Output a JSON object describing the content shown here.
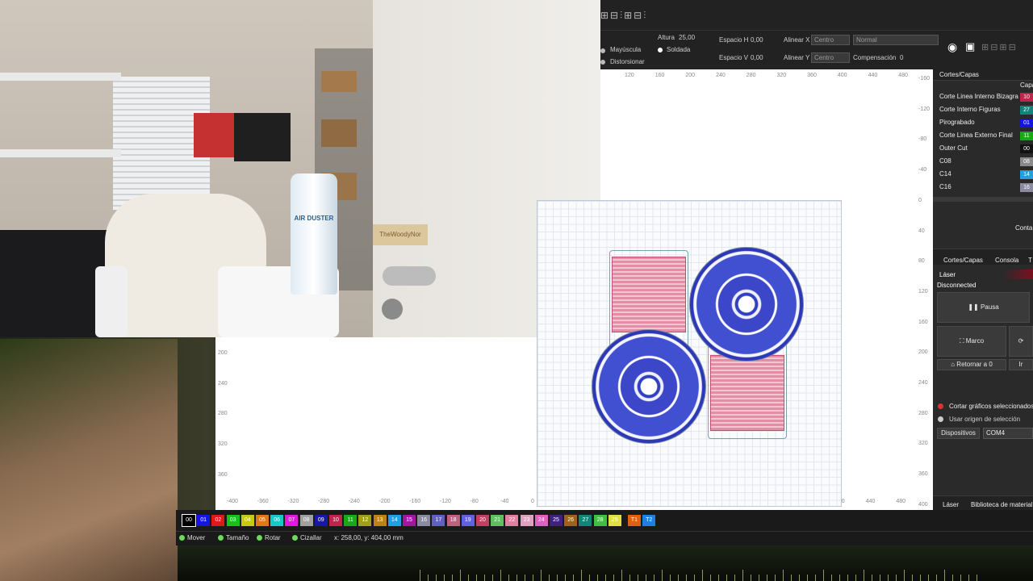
{
  "webcam": {
    "bottle_label": "AIR DUSTER",
    "nameplate": "TheWoodyNor"
  },
  "toolbar": {
    "altura_label": "Altura",
    "altura_value": "25,00",
    "mayuscula_label": "Mayúscula",
    "soldada_label": "Soldada",
    "distorsionar_label": "Distorsionar",
    "espacio_h_label": "Espacio H",
    "espacio_h_value": "0,00",
    "espacio_v_label": "Espacio V",
    "espacio_v_value": "0,00",
    "alinear_x_label": "Alinear X",
    "alinear_x_value": "Centro",
    "alinear_y_label": "Alinear Y",
    "alinear_y_value": "Centro",
    "normal_value": "Normal",
    "compensacion_label": "Compensación",
    "compensacion_value": "0"
  },
  "canvas": {
    "top_ticks": [
      "120",
      "160",
      "200",
      "240",
      "280",
      "320",
      "360",
      "400",
      "440",
      "480"
    ],
    "right_ticks": [
      "-160",
      "-120",
      "-80",
      "-40",
      "0",
      "40",
      "80",
      "120",
      "160",
      "200",
      "240",
      "280",
      "320",
      "360",
      "400"
    ],
    "bottom_ticks": [
      "-400",
      "-360",
      "-320",
      "-280",
      "-240",
      "-200",
      "-160",
      "-120",
      "-80",
      "-40",
      "0",
      "40",
      "80",
      "120",
      "160",
      "200",
      "240",
      "280",
      "320",
      "360",
      "400",
      "440",
      "480"
    ],
    "left_ticks": [
      "200",
      "240",
      "280",
      "320",
      "360"
    ]
  },
  "layers_panel": {
    "title": "Cortes/Capas",
    "col_header": "Capa",
    "layers": [
      {
        "name": "Corte Linea Interno Bizagra",
        "code": "10",
        "color": "#c0244a"
      },
      {
        "name": "Corte Interno Figuras",
        "code": "27",
        "color": "#13847a"
      },
      {
        "name": "Pirograbado",
        "code": "01",
        "color": "#1515e0"
      },
      {
        "name": "Corte Linea Externo Final",
        "code": "11",
        "color": "#18a818"
      },
      {
        "name": "Outer Cut",
        "code": "00",
        "color": "#111111"
      },
      {
        "name": "C08",
        "code": "08",
        "color": "#8a8a8a"
      },
      {
        "name": "C14",
        "code": "14",
        "color": "#20a0e0"
      },
      {
        "name": "C16",
        "code": "16",
        "color": "#8a8aa0"
      }
    ],
    "conta_text": "Conta"
  },
  "laser_panel": {
    "tab_layers": "Cortes/Capas",
    "tab_console": "Consola",
    "tab_more": "T",
    "section_title": "Láser",
    "status": "Disconnected",
    "pause_label": "Pausa",
    "frame_label": "Marco",
    "home_label": "Retornar a 0",
    "ir_label": "Ir",
    "cut_selected_label": "Cortar gráficos seleccionados",
    "use_origin_label": "Usar origen de selección",
    "devices_label": "Dispositivos",
    "port_value": "COM4",
    "bottom_tab_laser": "Láser",
    "bottom_tab_library": "Biblioteca de material"
  },
  "palette": [
    {
      "code": "00",
      "color": "#000000"
    },
    {
      "code": "01",
      "color": "#1515e0"
    },
    {
      "code": "02",
      "color": "#e01818"
    },
    {
      "code": "03",
      "color": "#18c018"
    },
    {
      "code": "04",
      "color": "#c8c818"
    },
    {
      "code": "05",
      "color": "#e07818"
    },
    {
      "code": "06",
      "color": "#18c8c8"
    },
    {
      "code": "07",
      "color": "#e018e0"
    },
    {
      "code": "08",
      "color": "#a0a0a0"
    },
    {
      "code": "09",
      "color": "#1818a0"
    },
    {
      "code": "10",
      "color": "#c0244a"
    },
    {
      "code": "11",
      "color": "#18a818"
    },
    {
      "code": "12",
      "color": "#a0a018"
    },
    {
      "code": "13",
      "color": "#c08018"
    },
    {
      "code": "14",
      "color": "#20a0e0"
    },
    {
      "code": "15",
      "color": "#a018a0"
    },
    {
      "code": "16",
      "color": "#8a8aa0"
    },
    {
      "code": "17",
      "color": "#6060c0"
    },
    {
      "code": "18",
      "color": "#c06080"
    },
    {
      "code": "19",
      "color": "#6060e0"
    },
    {
      "code": "20",
      "color": "#c04060"
    },
    {
      "code": "21",
      "color": "#60c060"
    },
    {
      "code": "22",
      "color": "#e080a0"
    },
    {
      "code": "23",
      "color": "#e0a0c0"
    },
    {
      "code": "24",
      "color": "#e060c0"
    },
    {
      "code": "25",
      "color": "#402080"
    },
    {
      "code": "26",
      "color": "#a06020"
    },
    {
      "code": "27",
      "color": "#13847a"
    },
    {
      "code": "28",
      "color": "#40c040"
    },
    {
      "code": "29",
      "color": "#e0e040"
    },
    {
      "code": "T1",
      "color": "#e06010"
    },
    {
      "code": "T2",
      "color": "#2080e0"
    }
  ],
  "statusbar": {
    "move_label": "Mover",
    "size_label": "Tamaño",
    "rotate_label": "Rotar",
    "shear_label": "Cizallar",
    "coords": "x: 258,00, y: 404,00 mm"
  }
}
